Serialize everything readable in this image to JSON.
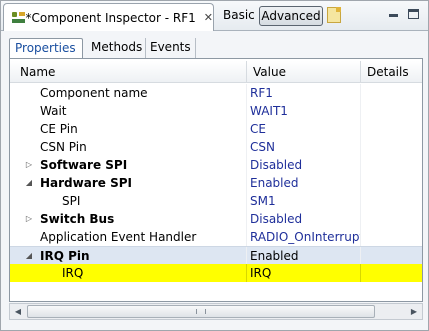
{
  "view_tab": {
    "title": "*Component Inspector - RF1",
    "close_glyph": "✕"
  },
  "toolbar": {
    "basic_label": "Basic",
    "advanced_label": "Advanced"
  },
  "tabs": [
    {
      "label": "Properties",
      "active": true
    },
    {
      "label": "Methods",
      "active": false
    },
    {
      "label": "Events",
      "active": false
    }
  ],
  "table": {
    "columns": {
      "name": "Name",
      "value": "Value",
      "details": "Details"
    },
    "rows": [
      {
        "name": "Component name",
        "value": "RF1",
        "level": 1,
        "bold": false,
        "twisty": ""
      },
      {
        "name": "Wait",
        "value": "WAIT1",
        "level": 1,
        "bold": false,
        "twisty": ""
      },
      {
        "name": "CE Pin",
        "value": "CE",
        "level": 1,
        "bold": false,
        "twisty": ""
      },
      {
        "name": "CSN Pin",
        "value": "CSN",
        "level": 1,
        "bold": false,
        "twisty": ""
      },
      {
        "name": "Software SPI",
        "value": "Disabled",
        "level": 1,
        "bold": true,
        "twisty": "collapsed"
      },
      {
        "name": "Hardware SPI",
        "value": "Enabled",
        "level": 1,
        "bold": true,
        "twisty": "expanded"
      },
      {
        "name": "SPI",
        "value": "SM1",
        "level": 2,
        "bold": false,
        "twisty": ""
      },
      {
        "name": "Switch Bus",
        "value": "Disabled",
        "level": 1,
        "bold": true,
        "twisty": "collapsed"
      },
      {
        "name": "Application Event Handler",
        "value": "RADIO_OnInterrupt",
        "level": 1,
        "bold": false,
        "twisty": ""
      },
      {
        "name": "IRQ Pin",
        "value": "Enabled",
        "level": 1,
        "bold": true,
        "twisty": "expanded",
        "state": "selected"
      },
      {
        "name": "IRQ",
        "value": "IRQ",
        "level": 2,
        "bold": false,
        "twisty": "",
        "state": "highlight"
      }
    ]
  },
  "colors": {
    "value_text": "#1f2f9a",
    "highlight_row": "#ffff00",
    "selected_row": "#dde6f2"
  }
}
